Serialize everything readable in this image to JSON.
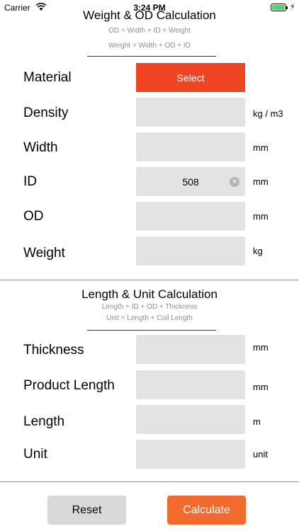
{
  "status_bar": {
    "carrier": "Carrier",
    "time": "3:24 PM",
    "battery_level": 1.0
  },
  "weight_section": {
    "title": "Weight & OD Calculation",
    "formula1": "OD = Width + ID + Weight",
    "formula2": "Weight = Width + OD + ID",
    "material_label": "Material",
    "select_label": "Select",
    "density_label": "Density",
    "density_value": "",
    "density_unit": "kg / m3",
    "width_label": "Width",
    "width_value": "",
    "width_unit": "mm",
    "id_label": "ID",
    "id_value": "508",
    "id_unit": "mm",
    "od_label": "OD",
    "od_value": "",
    "od_unit": "mm",
    "weight_label": "Weight",
    "weight_value": "",
    "weight_unit": "kg"
  },
  "length_section": {
    "title": "Length & Unit Calculation",
    "formula1": "Length = ID + OD + Thickness",
    "formula2": "Unit = Length + Coil Length",
    "thickness_label": "Thickness",
    "thickness_value": "",
    "thickness_unit": "mm",
    "product_length_label": "Product Length",
    "product_length_value": "",
    "product_length_unit": "mm",
    "length_label": "Length",
    "length_value": "",
    "length_unit": "m",
    "unit_label": "Unit",
    "unit_value": "",
    "unit_unit": "unit"
  },
  "buttons": {
    "reset": "Reset",
    "calculate": "Calculate"
  },
  "colors": {
    "select": "#ef4523",
    "calculate": "#f26a2e",
    "reset": "#d8d8d8",
    "field": "#e3e3e3"
  }
}
